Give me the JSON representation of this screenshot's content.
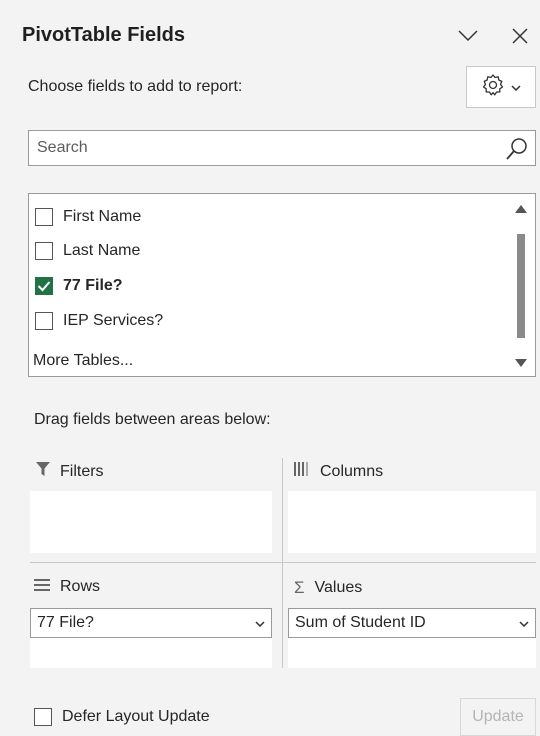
{
  "panel": {
    "title": "PivotTable Fields",
    "subtitle": "Choose fields to add to report:"
  },
  "search": {
    "placeholder": "Search"
  },
  "fields": [
    {
      "label": "First Name",
      "checked": false,
      "bold": false
    },
    {
      "label": "Last Name",
      "checked": false,
      "bold": false
    },
    {
      "label": "77 File?",
      "checked": true,
      "bold": true
    },
    {
      "label": "IEP Services?",
      "checked": false,
      "bold": false
    }
  ],
  "more_tables": "More Tables...",
  "areas": {
    "instruction": "Drag fields between areas below:",
    "filters": {
      "label": "Filters"
    },
    "columns": {
      "label": "Columns"
    },
    "rows": {
      "label": "Rows",
      "items": [
        "77 File?"
      ]
    },
    "values": {
      "label": "Values",
      "items": [
        "Sum of Student ID"
      ]
    }
  },
  "footer": {
    "defer_label": "Defer Layout Update",
    "update_label": "Update"
  },
  "colors": {
    "check_accent": "#217346"
  }
}
